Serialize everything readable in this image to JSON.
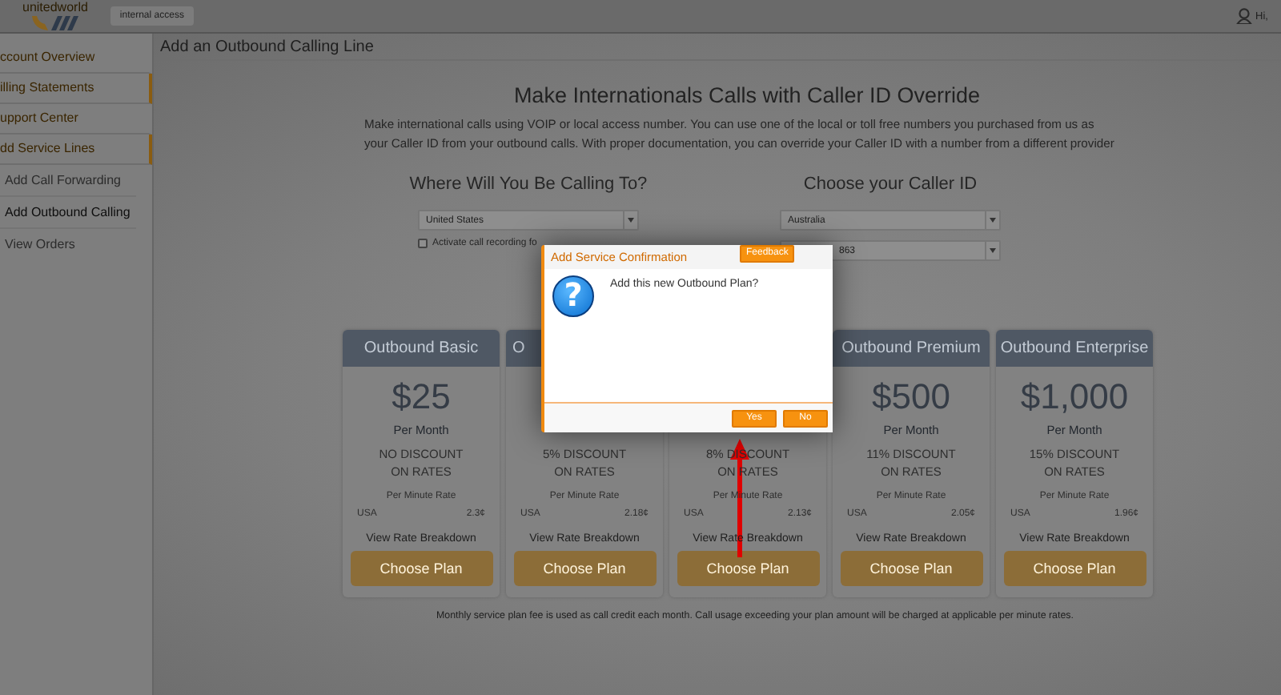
{
  "header": {
    "logo": "unitedworld",
    "access_button": "internal access",
    "user_greeting": "Hi,"
  },
  "sidebar": {
    "items": [
      {
        "label": "ccount Overview",
        "highlighted": false
      },
      {
        "label": "illing Statements",
        "highlighted": true
      },
      {
        "label": "upport Center",
        "highlighted": false
      },
      {
        "label": "dd Service Lines",
        "highlighted": true
      }
    ],
    "sub_items": [
      {
        "label": "Add Call Forwarding",
        "selected": false
      },
      {
        "label": "Add Outbound Calling",
        "selected": true
      },
      {
        "label": "View Orders",
        "selected": false
      }
    ]
  },
  "page_title": "Add an Outbound Calling Line",
  "heading": "Make Internationals Calls with Caller ID Override",
  "intro": "Make international calls using VOIP or local access number. You can use one of the local or toll free numbers you purchased from us as your Caller ID from your outbound calls. With proper documentation, you can override your Caller ID with a number from a different provider",
  "destination": {
    "heading": "Where Will You Be Calling To?",
    "country": "United States",
    "recording_label": "Activate call recording fo",
    "recording_checked": false
  },
  "caller_id": {
    "heading": "Choose your Caller ID",
    "country": "Australia",
    "number": "863"
  },
  "plans": [
    {
      "title": "Outbound Basic",
      "price": "$25",
      "period": "Per Month",
      "discount": "NO DISCOUNT",
      "discount_2": "ON RATES",
      "rate_label": "Per Minute Rate",
      "country": "USA",
      "rate": "2.3¢",
      "link": "View Rate Breakdown",
      "button": "Choose Plan"
    },
    {
      "title": "O",
      "discount": "5% DISCOUNT",
      "discount_2": "ON RATES",
      "rate_label": "Per Minute Rate",
      "country": "USA",
      "rate": "2.18¢",
      "link": "View Rate Breakdown",
      "button": "Choose Plan"
    },
    {
      "discount": "8% DISCOUNT",
      "discount_2": "ON RATES",
      "rate_label": "Per Minute Rate",
      "country": "USA",
      "rate": "2.13¢",
      "link": "View Rate Breakdown",
      "button": "Choose Plan"
    },
    {
      "title": "Outbound Premium",
      "price": "$500",
      "period": "Per Month",
      "discount": "11% DISCOUNT",
      "discount_2": "ON RATES",
      "rate_label": "Per Minute Rate",
      "country": "USA",
      "rate": "2.05¢",
      "link": "View Rate Breakdown",
      "button": "Choose Plan"
    },
    {
      "title": "Outbound Enterprise",
      "price": "$1,000",
      "period": "Per Month",
      "discount": "15% DISCOUNT",
      "discount_2": "ON RATES",
      "rate_label": "Per Minute Rate",
      "country": "USA",
      "rate": "1.96¢",
      "link": "View Rate Breakdown",
      "button": "Choose Plan"
    }
  ],
  "footnote": "Monthly service plan fee is used as call credit each month. Call usage exceeding your plan amount will be charged at applicable per minute rates.",
  "dialog": {
    "title": "Add Service Confirmation",
    "feedback_tab": "Feedback",
    "icon_glyph": "?",
    "message": "Add this new Outbound Plan?",
    "buttons": [
      "Yes",
      "No"
    ]
  }
}
